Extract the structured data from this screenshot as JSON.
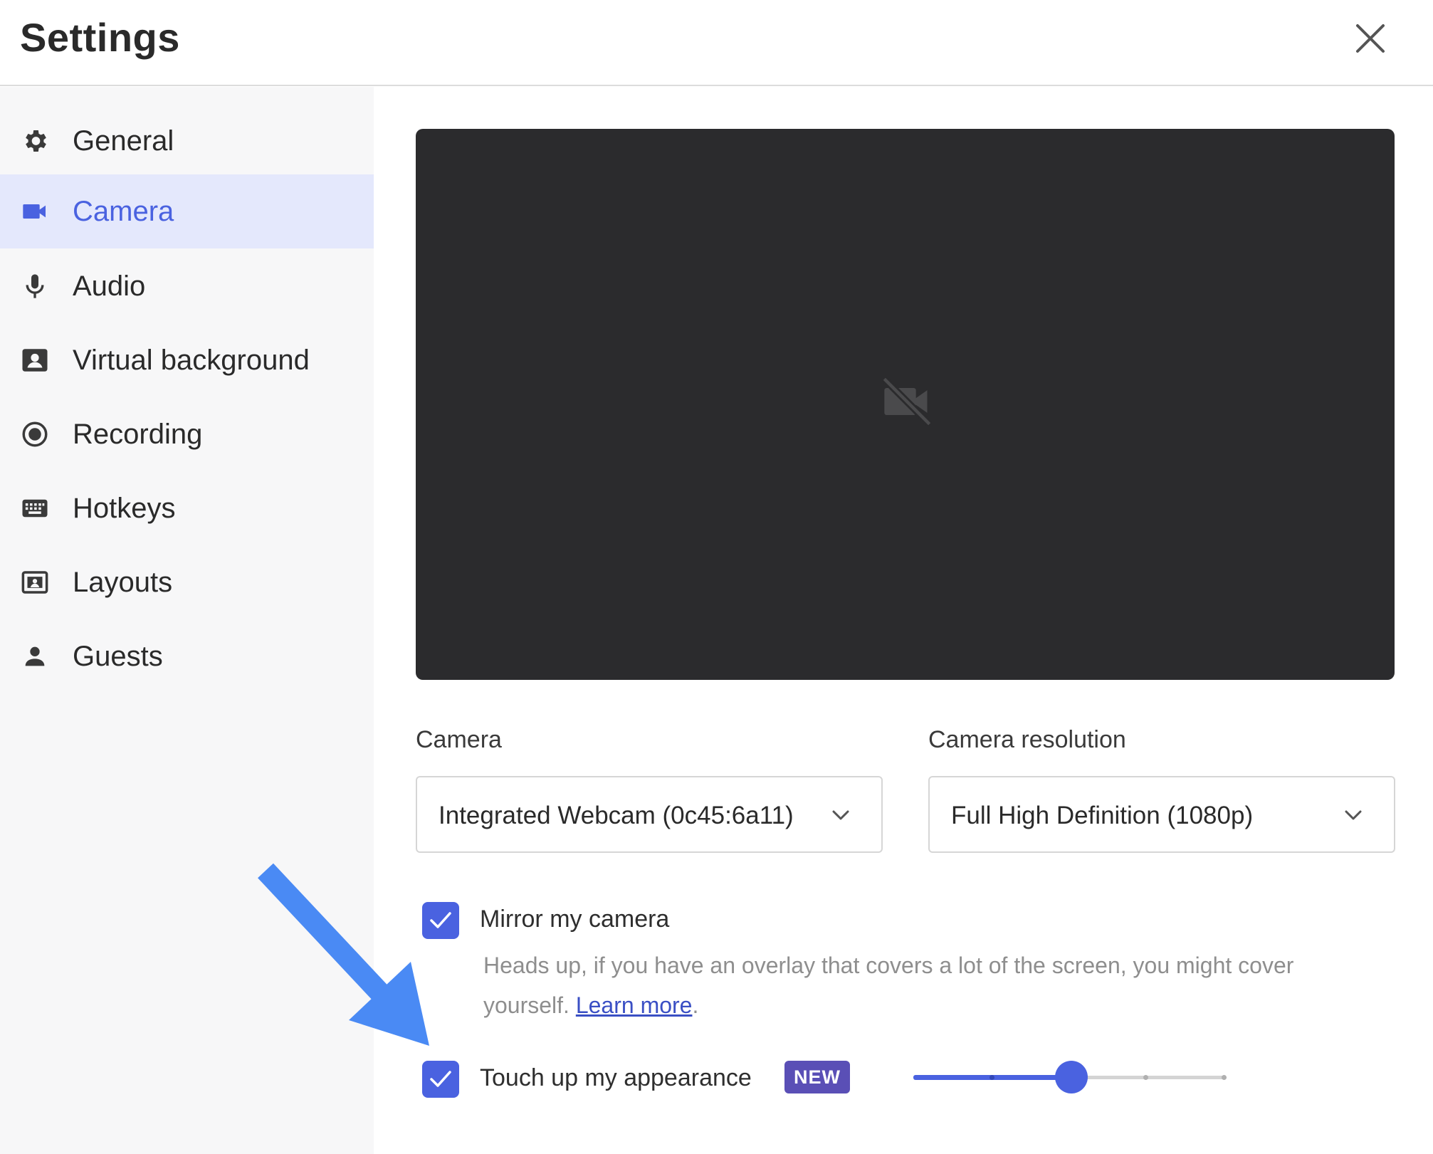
{
  "window": {
    "title": "Settings"
  },
  "sidebar": {
    "items": [
      {
        "label": "General",
        "icon": "gear-icon",
        "active": false
      },
      {
        "label": "Camera",
        "icon": "video-camera-icon",
        "active": true
      },
      {
        "label": "Audio",
        "icon": "microphone-icon",
        "active": false
      },
      {
        "label": "Virtual background",
        "icon": "portrait-icon",
        "active": false
      },
      {
        "label": "Recording",
        "icon": "record-icon",
        "active": false
      },
      {
        "label": "Hotkeys",
        "icon": "keyboard-icon",
        "active": false
      },
      {
        "label": "Layouts",
        "icon": "layout-icon",
        "active": false
      },
      {
        "label": "Guests",
        "icon": "person-icon",
        "active": false
      }
    ]
  },
  "camera_settings": {
    "preview_icon": "camera-off-icon",
    "camera_label": "Camera",
    "camera_value": "Integrated Webcam (0c45:6a11)",
    "resolution_label": "Camera resolution",
    "resolution_value": "Full High Definition (1080p)",
    "mirror": {
      "label": "Mirror my camera",
      "checked": true,
      "hint_text": "Heads up, if you have an overlay that covers a lot of the screen, you might cover yourself.",
      "learn_more": "Learn more",
      "hint_end": "."
    },
    "touch_up": {
      "label": "Touch up my appearance",
      "checked": true,
      "badge": "NEW",
      "slider_level": 0.5
    }
  },
  "colors": {
    "accent": "#4a62e0",
    "active_bg": "#e4e8fc",
    "preview_bg": "#2b2b2d",
    "badge_bg": "#5a4fb6",
    "annotation_arrow": "#4a8af4"
  }
}
